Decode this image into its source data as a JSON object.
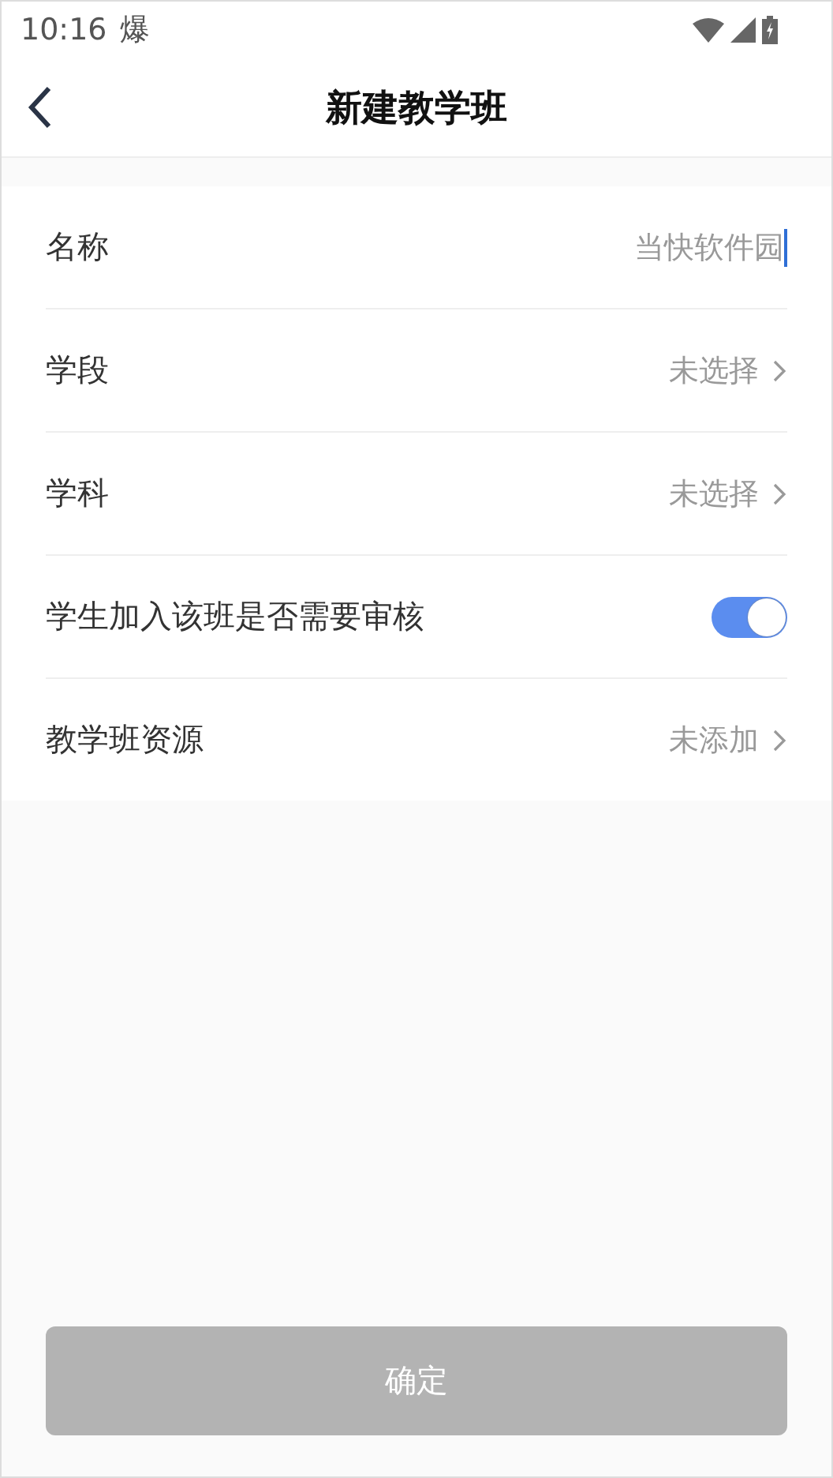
{
  "status_bar": {
    "time": "10:16",
    "notice": "爆"
  },
  "header": {
    "title": "新建教学班"
  },
  "form": [
    {
      "kind": "input",
      "label": "名称",
      "value": "当快软件园"
    },
    {
      "kind": "select",
      "label": "学段",
      "value": "未选择"
    },
    {
      "kind": "select",
      "label": "学科",
      "value": "未选择"
    },
    {
      "kind": "toggle",
      "label": "学生加入该班是否需要审核",
      "on": true
    },
    {
      "kind": "select",
      "label": "教学班资源",
      "value": "未添加"
    }
  ],
  "confirm": {
    "label": "确定",
    "disabled": true
  }
}
